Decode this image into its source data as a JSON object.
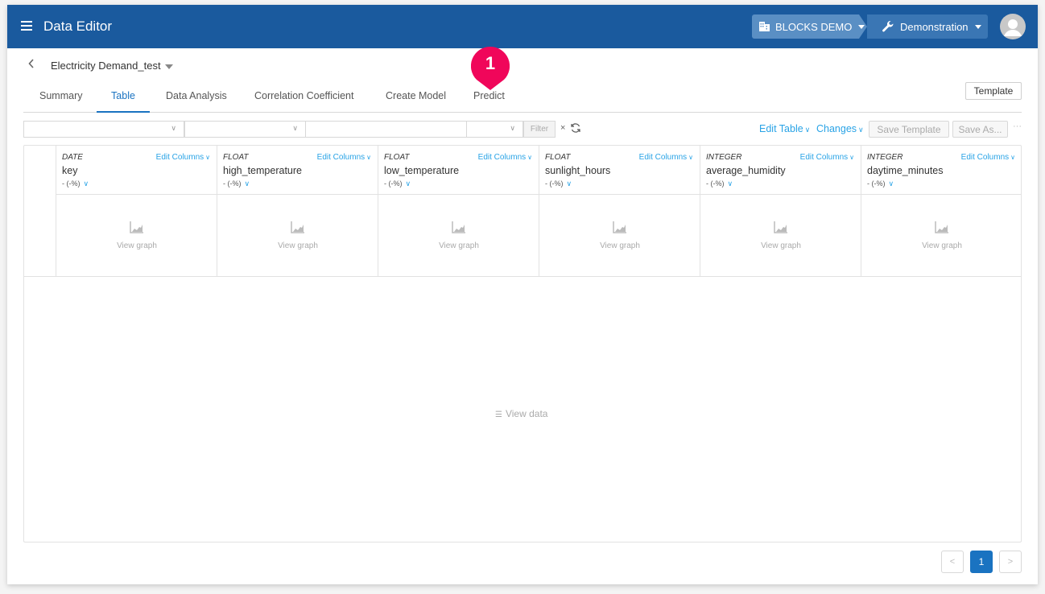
{
  "appbar": {
    "title": "Data Editor",
    "organization": "BLOCKS DEMO",
    "project": "Demonstration",
    "brand_color": "#1a5a9e"
  },
  "dataset": {
    "back_label": "<",
    "name": "Electricity Demand_test"
  },
  "tabs": [
    {
      "label": "Summary",
      "active": false
    },
    {
      "label": "Table",
      "active": true
    },
    {
      "label": "Data Analysis",
      "active": false
    },
    {
      "label": "Correlation Coefficient",
      "active": false
    },
    {
      "label": "Create Model",
      "active": false
    },
    {
      "label": "Predict",
      "active": false
    }
  ],
  "template_button": "Template",
  "annotation": {
    "number": "1",
    "color": "#f0065a",
    "target": "Predict"
  },
  "filter_bar": {
    "column_select": "",
    "operator_select": "",
    "value_input": "",
    "type_select": "",
    "filter_label": "Filter",
    "clear_label": "×"
  },
  "table_actions": {
    "edit_table": "Edit Table",
    "changes": "Changes",
    "save_template": "Save Template",
    "save_as": "Save As...",
    "more": "···"
  },
  "columns": [
    {
      "type": "DATE",
      "name": "key",
      "stat": "- (-%)",
      "edit": "Edit Columns",
      "graph": "View graph"
    },
    {
      "type": "FLOAT",
      "name": "high_temperature",
      "stat": "- (-%)",
      "edit": "Edit Columns",
      "graph": "View graph"
    },
    {
      "type": "FLOAT",
      "name": "low_temperature",
      "stat": "- (-%)",
      "edit": "Edit Columns",
      "graph": "View graph"
    },
    {
      "type": "FLOAT",
      "name": "sunlight_hours",
      "stat": "- (-%)",
      "edit": "Edit Columns",
      "graph": "View graph"
    },
    {
      "type": "INTEGER",
      "name": "average_humidity",
      "stat": "- (-%)",
      "edit": "Edit Columns",
      "graph": "View graph"
    },
    {
      "type": "INTEGER",
      "name": "daytime_minutes",
      "stat": "- (-%)",
      "edit": "Edit Columns",
      "graph": "View graph"
    }
  ],
  "view_data_label": "View data",
  "pagination": {
    "prev": "<",
    "current": "1",
    "next": ">"
  }
}
